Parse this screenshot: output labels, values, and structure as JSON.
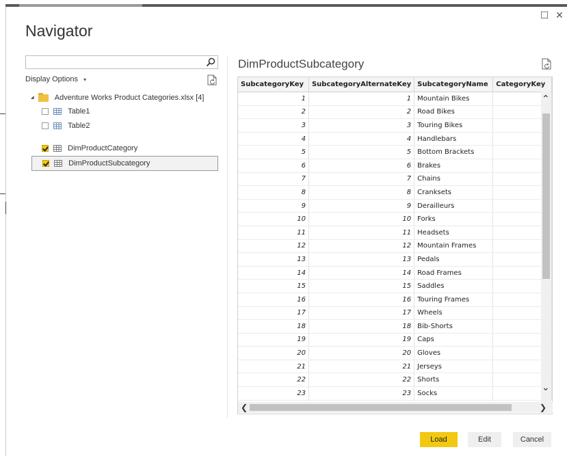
{
  "window": {
    "title": "Navigator",
    "maximize_glyph": "☐",
    "close_glyph": "✕"
  },
  "search": {
    "value": "",
    "placeholder": ""
  },
  "display_options": {
    "label": "Display Options",
    "caret": "▾"
  },
  "tree": {
    "root": {
      "label": "Adventure Works Product Categories.xlsx [4]",
      "expand_glyph": "◢"
    },
    "items": [
      {
        "label": "Table1",
        "checked": false,
        "icon": "table-icon"
      },
      {
        "label": "Table2",
        "checked": false,
        "icon": "table-icon"
      },
      {
        "label": "DimProductCategory",
        "checked": true,
        "icon": "table-icon"
      },
      {
        "label": "DimProductSubcategory",
        "checked": true,
        "icon": "table-icon",
        "selected": true
      }
    ]
  },
  "preview": {
    "title": "DimProductSubcategory",
    "columns": [
      "SubcategoryKey",
      "SubcategoryAlternateKey",
      "SubcategoryName",
      "CategoryKey"
    ],
    "rows": [
      [
        "1",
        "1",
        "Mountain Bikes",
        ""
      ],
      [
        "2",
        "2",
        "Road Bikes",
        ""
      ],
      [
        "3",
        "3",
        "Touring Bikes",
        ""
      ],
      [
        "4",
        "4",
        "Handlebars",
        ""
      ],
      [
        "5",
        "5",
        "Bottom Brackets",
        ""
      ],
      [
        "6",
        "6",
        "Brakes",
        ""
      ],
      [
        "7",
        "7",
        "Chains",
        ""
      ],
      [
        "8",
        "8",
        "Cranksets",
        ""
      ],
      [
        "9",
        "9",
        "Derailleurs",
        ""
      ],
      [
        "10",
        "10",
        "Forks",
        ""
      ],
      [
        "11",
        "11",
        "Headsets",
        ""
      ],
      [
        "12",
        "12",
        "Mountain Frames",
        ""
      ],
      [
        "13",
        "13",
        "Pedals",
        ""
      ],
      [
        "14",
        "14",
        "Road Frames",
        ""
      ],
      [
        "15",
        "15",
        "Saddles",
        ""
      ],
      [
        "16",
        "16",
        "Touring Frames",
        ""
      ],
      [
        "17",
        "17",
        "Wheels",
        ""
      ],
      [
        "18",
        "18",
        "Bib-Shorts",
        ""
      ],
      [
        "19",
        "19",
        "Caps",
        ""
      ],
      [
        "20",
        "20",
        "Gloves",
        ""
      ],
      [
        "21",
        "21",
        "Jerseys",
        ""
      ],
      [
        "22",
        "22",
        "Shorts",
        ""
      ],
      [
        "23",
        "23",
        "Socks",
        ""
      ]
    ]
  },
  "scroll_glyphs": {
    "up": "⌃",
    "down": "⌄",
    "left": "❮",
    "right": "❯"
  },
  "buttons": {
    "load": "Load",
    "edit": "Edit",
    "cancel": "Cancel"
  },
  "colors": {
    "accent": "#f2c811",
    "selected_row_border": "#999999"
  }
}
